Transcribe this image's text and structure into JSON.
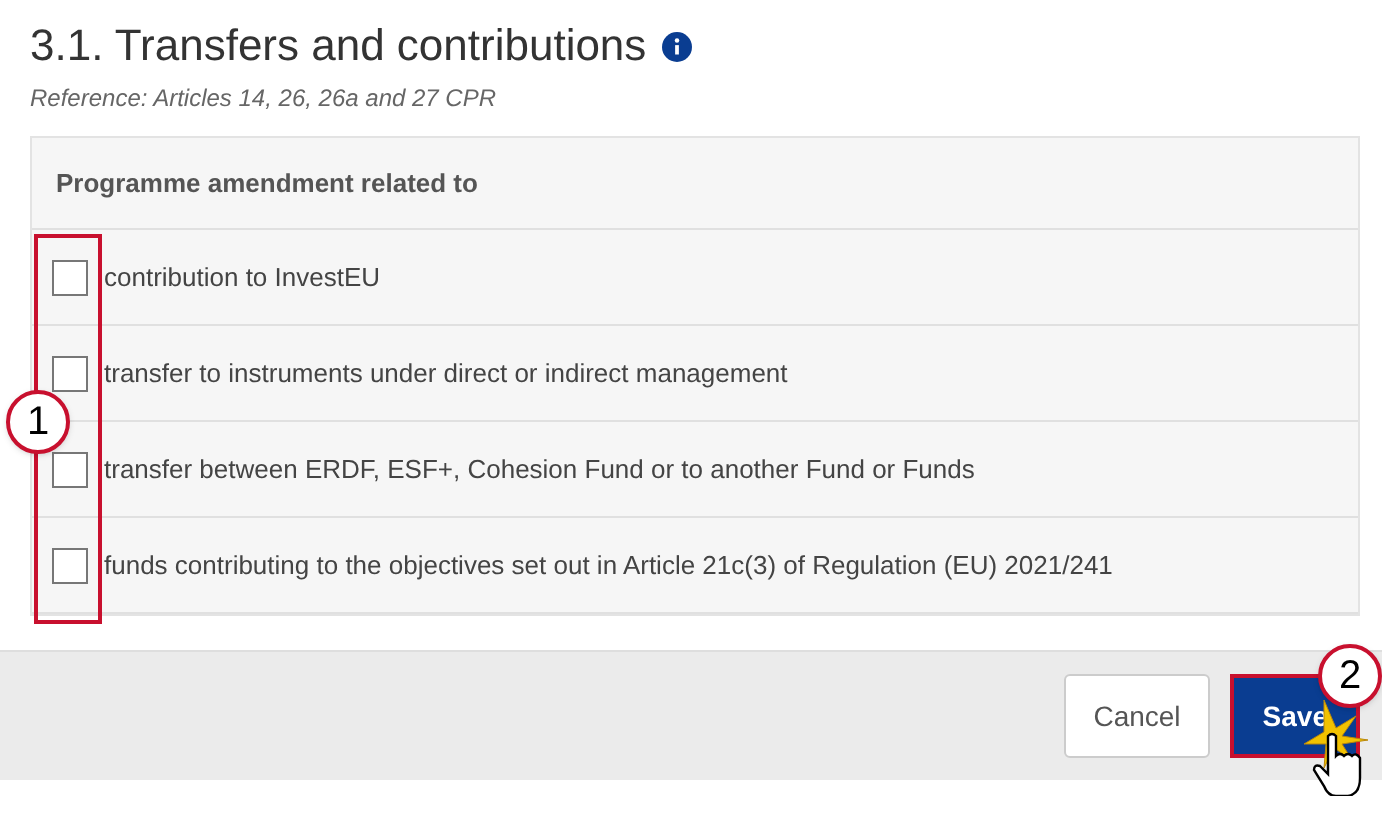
{
  "section": {
    "title": "3.1. Transfers and contributions",
    "reference": "Reference: Articles 14, 26, 26a and 27 CPR"
  },
  "table": {
    "header": "Programme amendment related to",
    "rows": [
      {
        "label": "contribution to InvestEU",
        "checked": false
      },
      {
        "label": "transfer to instruments under direct or indirect management",
        "checked": false
      },
      {
        "label": "transfer between ERDF, ESF+, Cohesion Fund or to another Fund or Funds",
        "checked": false
      },
      {
        "label": "funds contributing to the objectives set out in Article 21c(3) of Regulation (EU) 2021/241",
        "checked": false
      }
    ]
  },
  "buttons": [
    {
      "label": "Cancel",
      "kind": "secondary"
    },
    {
      "label": "Save",
      "kind": "primary"
    }
  ],
  "callouts": [
    "1",
    "2"
  ]
}
